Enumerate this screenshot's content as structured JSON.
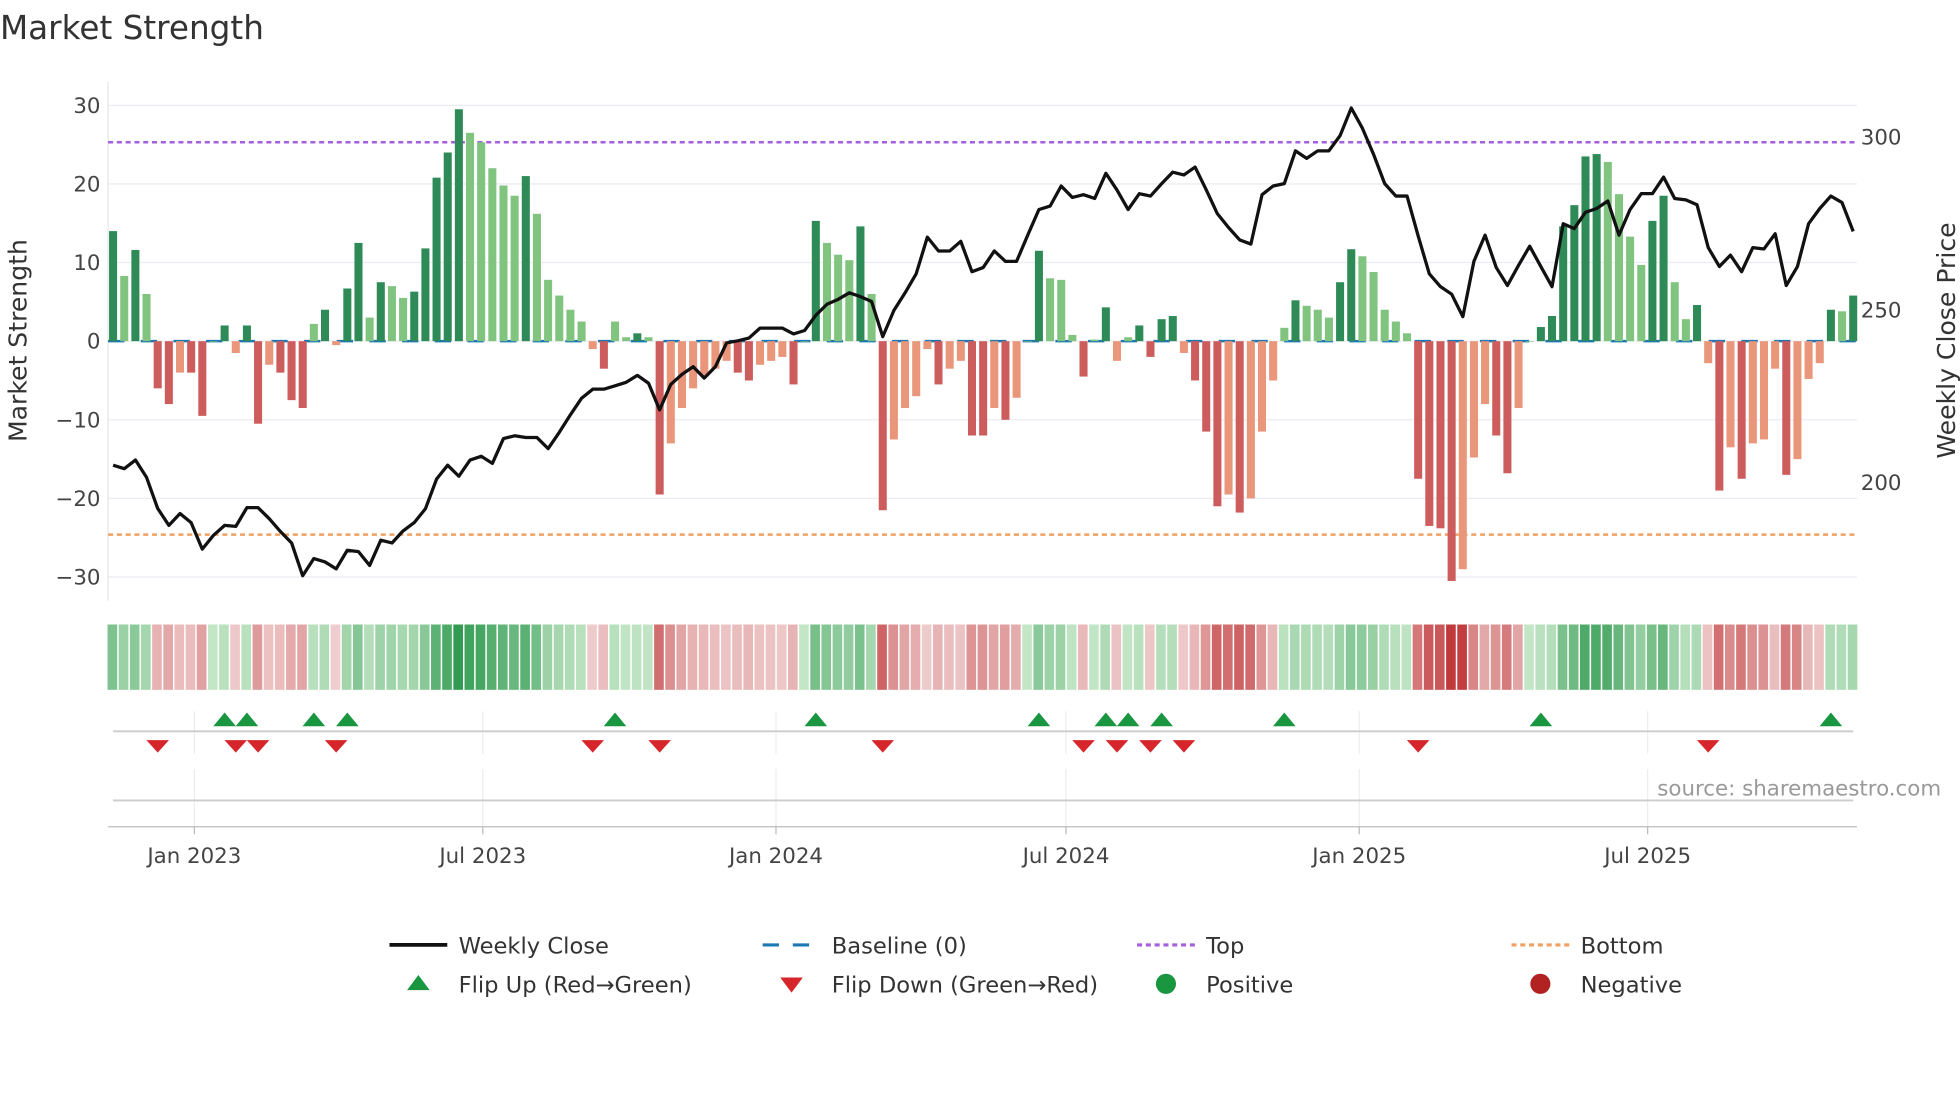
{
  "chart_data": {
    "type": "bar",
    "title": "Market Strength",
    "ylabel": "Market Strength",
    "y2label": "Weekly Close Price",
    "source": "source: sharemaestro.com",
    "ylim": [
      -33,
      33
    ],
    "y2lim": [
      165.8,
      316
    ],
    "yticks": [
      30,
      20,
      10,
      0,
      -10,
      -20,
      -30
    ],
    "yticklabels": [
      "30",
      "20",
      "10",
      "0",
      "−10",
      "−20",
      "−30"
    ],
    "y2ticks": [
      300,
      250,
      200
    ],
    "y2ticklabels": [
      "300",
      "250",
      "200"
    ],
    "x_start": "2022-11-11",
    "x_step_days": 7,
    "xticks": [
      {
        "label": "Jan 2023",
        "date": "2023-01-01"
      },
      {
        "label": "Jul 2023",
        "date": "2023-07-01"
      },
      {
        "label": "Jan 2024",
        "date": "2024-01-01"
      },
      {
        "label": "Jul 2024",
        "date": "2024-07-01"
      },
      {
        "label": "Jan 2025",
        "date": "2025-01-01"
      },
      {
        "label": "Jul 2025",
        "date": "2025-07-01"
      }
    ],
    "top_level": 25.3,
    "bottom_level": -24.6,
    "baseline": 0,
    "strength": [
      14,
      8.3,
      11.6,
      6,
      -6,
      -8,
      -4,
      -4,
      -9.5,
      0,
      2,
      -1.5,
      2,
      -10.5,
      -3,
      -4,
      -7.5,
      -8.5,
      2.2,
      4,
      -0.5,
      6.7,
      12.5,
      3,
      7.5,
      7,
      5.5,
      6.3,
      11.8,
      20.8,
      24,
      29.5,
      26.5,
      25.3,
      22,
      19.8,
      18.5,
      21,
      16.2,
      7.8,
      5.8,
      4,
      2.5,
      -1,
      -3.5,
      2.5,
      0.5,
      1,
      0.5,
      -19.5,
      -13,
      -8.5,
      -6,
      -4.5,
      -3.5,
      -2.5,
      -4,
      -5,
      -3,
      -2.5,
      -2,
      -5.5,
      0,
      15.3,
      12.5,
      11,
      10.3,
      14.6,
      6,
      -21.5,
      -12.5,
      -8.5,
      -7,
      -1,
      -5.5,
      -3.5,
      -2.5,
      -12,
      -12,
      -8.5,
      -10,
      -7.2,
      0,
      11.5,
      8,
      7.8,
      0.8,
      -4.5,
      0.2,
      4.3,
      -2.5,
      0.5,
      2,
      -2,
      2.8,
      3.2,
      -1.5,
      -5,
      -11.5,
      -21,
      -19.5,
      -21.8,
      -20,
      -11.5,
      -5,
      1.7,
      5.2,
      4.5,
      4,
      3,
      7.5,
      11.7,
      10.8,
      8.8,
      4,
      2.5,
      1,
      -17.5,
      -23.5,
      -23.8,
      -30.5,
      -29,
      -14.8,
      -8,
      -12,
      -16.8,
      -8.5,
      0,
      1.8,
      3.2,
      14.6,
      17.3,
      23.5,
      23.8,
      22.8,
      18.7,
      13.3,
      9.7,
      15.3,
      18.5,
      7.5,
      2.8,
      4.6,
      -2.8,
      -19,
      -13.5,
      -17.5,
      -13,
      -12.5,
      -3.5,
      -17,
      -15,
      -4.8,
      -2.8,
      4,
      3.8,
      5.8
    ],
    "weekly_close": [
      205,
      204,
      206.5,
      201.5,
      192.5,
      187.6,
      191,
      188.4,
      180.7,
      184.7,
      187.6,
      187.3,
      192.7,
      192.7,
      189.5,
      185.8,
      182.5,
      173,
      178,
      177,
      175,
      180.4,
      180,
      176,
      183.3,
      182.5,
      186,
      188.4,
      192.4,
      201,
      205,
      201.8,
      206.5,
      207.6,
      205.5,
      212.7,
      213.5,
      213,
      213,
      209.8,
      214.5,
      219.6,
      224.4,
      227,
      227,
      228,
      229,
      231,
      228.7,
      221,
      228.4,
      231.3,
      233.5,
      230.2,
      233.5,
      240.4,
      241,
      241.8,
      244.7,
      244.7,
      244.7,
      243,
      244,
      248.4,
      251.6,
      253,
      254.9,
      253.8,
      252.4,
      242.2,
      249.8,
      254.9,
      260.4,
      271,
      267,
      267,
      269.8,
      261,
      262.2,
      267,
      264,
      264,
      271.6,
      279,
      280,
      285.8,
      282.5,
      283.3,
      282.2,
      289.5,
      284.7,
      279,
      283.6,
      282.9,
      286.5,
      289.8,
      289,
      291.3,
      284.7,
      277.8,
      273.8,
      270.2,
      269,
      283.3,
      285.8,
      286.5,
      296,
      293.8,
      296,
      296,
      300.4,
      308.4,
      302.5,
      295,
      286.5,
      282.9,
      282.9,
      271.3,
      260.4,
      256.7,
      254.5,
      248,
      264,
      271.6,
      262.2,
      257,
      262.9,
      268.4,
      262.5,
      256.7,
      274.9,
      273.5,
      278.2,
      279.3,
      281.5,
      271.6,
      279,
      283.6,
      283.6,
      288.4,
      282.2,
      281.8,
      280.4,
      268,
      262.5,
      265.8,
      261,
      268,
      267.6,
      272,
      257,
      262.5,
      274.9,
      279.3,
      282.9,
      281,
      272.7
    ],
    "flip_up_weeks": [
      10,
      12,
      18,
      21,
      45,
      63,
      83,
      89,
      91,
      94,
      105,
      128,
      154
    ],
    "flip_down_weeks": [
      4,
      11,
      13,
      20,
      43,
      49,
      69,
      87,
      90,
      93,
      96,
      117,
      143
    ],
    "legend": [
      {
        "label": "Weekly Close",
        "kind": "line"
      },
      {
        "label": "Baseline (0)",
        "kind": "dash"
      },
      {
        "label": "Top",
        "kind": "dot-purple"
      },
      {
        "label": "Bottom",
        "kind": "dot-orange"
      },
      {
        "label": "Flip Up (Red→Green)",
        "kind": "tri-up"
      },
      {
        "label": "Flip Down (Green→Red)",
        "kind": "tri-down"
      },
      {
        "label": "Positive",
        "kind": "dot-green"
      },
      {
        "label": "Negative",
        "kind": "dot-red"
      }
    ],
    "legend_placement": "bottom",
    "colors": {
      "pos_strong": "#2e8b57",
      "pos_weak": "#80c480",
      "neg_strong": "#cd5c5c",
      "neg_weak": "#e9967a",
      "close": "#111111",
      "baseline": "#1f77b4",
      "top": "#a35fe0",
      "bottom": "#f0a060",
      "flip_up": "#1a9641",
      "flip_down": "#d7262b",
      "positive": "#1a9641",
      "negative": "#b22222"
    }
  }
}
